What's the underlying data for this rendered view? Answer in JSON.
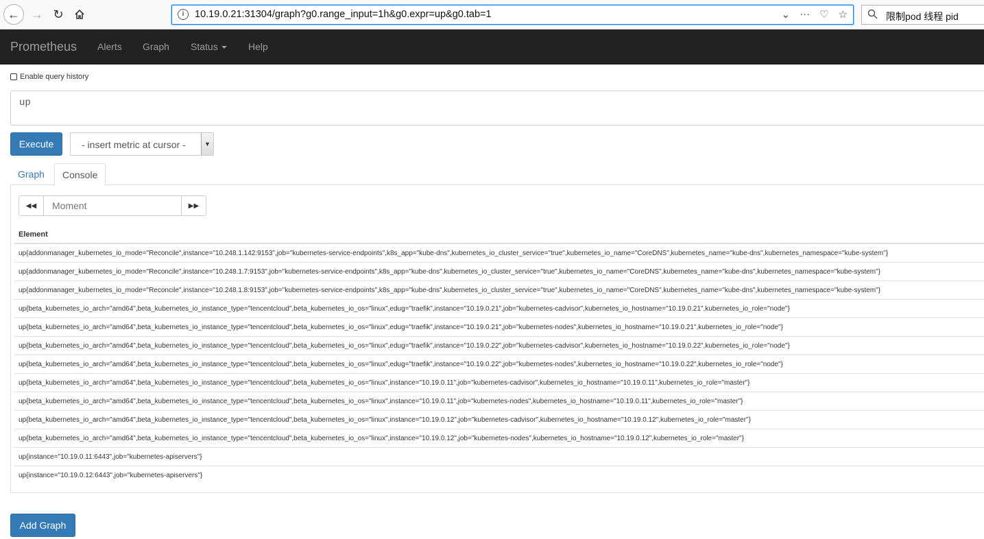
{
  "browser": {
    "url": "10.19.0.21:31304/graph?g0.range_input=1h&g0.expr=up&g0.tab=1",
    "search_text": "限制pod 线程 pid"
  },
  "navbar": {
    "brand": "Prometheus",
    "items": [
      "Alerts",
      "Graph",
      "Status",
      "Help"
    ]
  },
  "query": {
    "history_label": "Enable query history",
    "expression": "up",
    "execute_label": "Execute",
    "metric_placeholder": "- insert metric at cursor -"
  },
  "tabs": [
    "Graph",
    "Console"
  ],
  "console": {
    "moment_placeholder": "Moment",
    "header": "Element",
    "rows": [
      "up{addonmanager_kubernetes_io_mode=\"Reconcile\",instance=\"10.248.1.142:9153\",job=\"kubernetes-service-endpoints\",k8s_app=\"kube-dns\",kubernetes_io_cluster_service=\"true\",kubernetes_io_name=\"CoreDNS\",kubernetes_name=\"kube-dns\",kubernetes_namespace=\"kube-system\"}",
      "up{addonmanager_kubernetes_io_mode=\"Reconcile\",instance=\"10.248.1.7:9153\",job=\"kubernetes-service-endpoints\",k8s_app=\"kube-dns\",kubernetes_io_cluster_service=\"true\",kubernetes_io_name=\"CoreDNS\",kubernetes_name=\"kube-dns\",kubernetes_namespace=\"kube-system\"}",
      "up{addonmanager_kubernetes_io_mode=\"Reconcile\",instance=\"10.248.1.8:9153\",job=\"kubernetes-service-endpoints\",k8s_app=\"kube-dns\",kubernetes_io_cluster_service=\"true\",kubernetes_io_name=\"CoreDNS\",kubernetes_name=\"kube-dns\",kubernetes_namespace=\"kube-system\"}",
      "up{beta_kubernetes_io_arch=\"amd64\",beta_kubernetes_io_instance_type=\"tencentcloud\",beta_kubernetes_io_os=\"linux\",edug=\"traefik\",instance=\"10.19.0.21\",job=\"kubernetes-cadvisor\",kubernetes_io_hostname=\"10.19.0.21\",kubernetes_io_role=\"node\"}",
      "up{beta_kubernetes_io_arch=\"amd64\",beta_kubernetes_io_instance_type=\"tencentcloud\",beta_kubernetes_io_os=\"linux\",edug=\"traefik\",instance=\"10.19.0.21\",job=\"kubernetes-nodes\",kubernetes_io_hostname=\"10.19.0.21\",kubernetes_io_role=\"node\"}",
      "up{beta_kubernetes_io_arch=\"amd64\",beta_kubernetes_io_instance_type=\"tencentcloud\",beta_kubernetes_io_os=\"linux\",edug=\"traefik\",instance=\"10.19.0.22\",job=\"kubernetes-cadvisor\",kubernetes_io_hostname=\"10.19.0.22\",kubernetes_io_role=\"node\"}",
      "up{beta_kubernetes_io_arch=\"amd64\",beta_kubernetes_io_instance_type=\"tencentcloud\",beta_kubernetes_io_os=\"linux\",edug=\"traefik\",instance=\"10.19.0.22\",job=\"kubernetes-nodes\",kubernetes_io_hostname=\"10.19.0.22\",kubernetes_io_role=\"node\"}",
      "up{beta_kubernetes_io_arch=\"amd64\",beta_kubernetes_io_instance_type=\"tencentcloud\",beta_kubernetes_io_os=\"linux\",instance=\"10.19.0.11\",job=\"kubernetes-cadvisor\",kubernetes_io_hostname=\"10.19.0.11\",kubernetes_io_role=\"master\"}",
      "up{beta_kubernetes_io_arch=\"amd64\",beta_kubernetes_io_instance_type=\"tencentcloud\",beta_kubernetes_io_os=\"linux\",instance=\"10.19.0.11\",job=\"kubernetes-nodes\",kubernetes_io_hostname=\"10.19.0.11\",kubernetes_io_role=\"master\"}",
      "up{beta_kubernetes_io_arch=\"amd64\",beta_kubernetes_io_instance_type=\"tencentcloud\",beta_kubernetes_io_os=\"linux\",instance=\"10.19.0.12\",job=\"kubernetes-cadvisor\",kubernetes_io_hostname=\"10.19.0.12\",kubernetes_io_role=\"master\"}",
      "up{beta_kubernetes_io_arch=\"amd64\",beta_kubernetes_io_instance_type=\"tencentcloud\",beta_kubernetes_io_os=\"linux\",instance=\"10.19.0.12\",job=\"kubernetes-nodes\",kubernetes_io_hostname=\"10.19.0.12\",kubernetes_io_role=\"master\"}",
      "up{instance=\"10.19.0.11:6443\",job=\"kubernetes-apiservers\"}",
      "up{instance=\"10.19.0.12:6443\",job=\"kubernetes-apiservers\"}"
    ]
  },
  "add_graph_label": "Add Graph"
}
